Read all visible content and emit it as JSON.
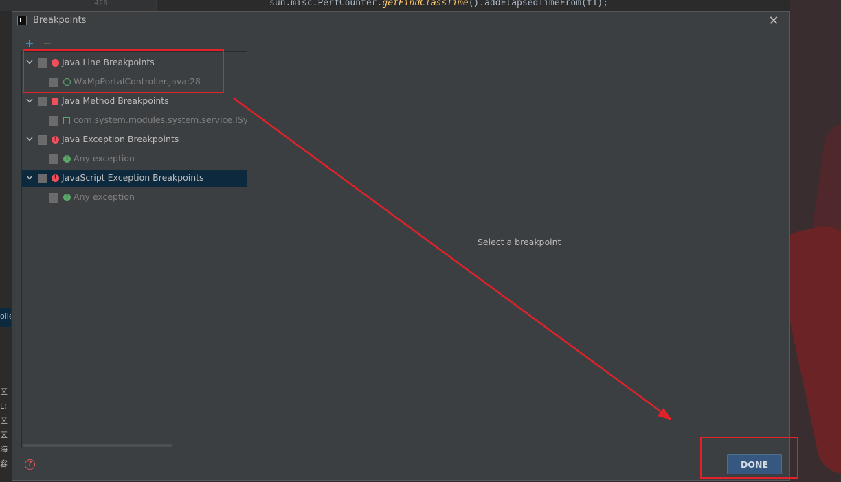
{
  "editor": {
    "line_number": "428",
    "code_prefix": "sun.misc.PerfCounter.",
    "code_method": "getFindClassTime",
    "code_suffix": "().addElapsedTimeFrom(t1);",
    "left_tab_text": "olle",
    "left_log_lines": [
      "区",
      "L;",
      "区",
      "区",
      "海",
      "容"
    ]
  },
  "dialog": {
    "title": "Breakpoints",
    "app_icon": "intellij-icon",
    "close_icon": "close-icon",
    "toolbar": {
      "add_label": "+",
      "remove_label": "−"
    },
    "tree": [
      {
        "label": "Java Line Breakpoints",
        "icon": "red-dot-breakpoint-icon",
        "expanded": true,
        "checked": false,
        "children": [
          {
            "label": "WxMpPortalController.java:28",
            "icon": "green-ring-breakpoint-icon",
            "checked": false
          }
        ]
      },
      {
        "label": "Java Method Breakpoints",
        "icon": "red-square-breakpoint-icon",
        "expanded": true,
        "checked": false,
        "children": [
          {
            "label": "com.system.modules.system.service.ISysUse",
            "icon": "green-square-breakpoint-icon",
            "checked": false
          }
        ]
      },
      {
        "label": "Java Exception Breakpoints",
        "icon": "red-exclamation-breakpoint-icon",
        "expanded": true,
        "checked": false,
        "children": [
          {
            "label": "Any exception",
            "icon": "green-exclamation-breakpoint-icon",
            "checked": false
          }
        ]
      },
      {
        "label": "JavaScript Exception Breakpoints",
        "icon": "red-exclamation-breakpoint-icon",
        "expanded": true,
        "checked": false,
        "selected": true,
        "children": [
          {
            "label": "Any exception",
            "icon": "green-exclamation-breakpoint-icon",
            "checked": false
          }
        ]
      }
    ],
    "placeholder": "Select a breakpoint",
    "help_label": "?",
    "done_label": "DONE"
  },
  "colors": {
    "dialog_bg": "#3c3f41",
    "selection_bg": "#0d293e",
    "accent_blue": "#365880",
    "breakpoint_red": "#f0505c",
    "breakpoint_green": "#59a869",
    "annotation_red": "#e0222a"
  }
}
